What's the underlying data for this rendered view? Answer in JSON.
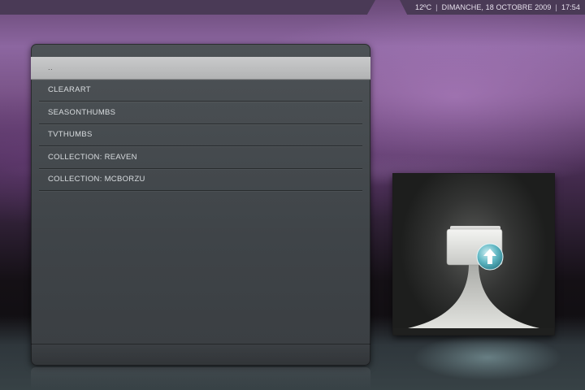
{
  "status_bar": {
    "temperature": "12ºC",
    "date": "DIMANCHE, 18 OCTOBRE 2009",
    "time": "17:54",
    "separator": "|"
  },
  "file_list": {
    "items": [
      {
        "label": "..",
        "selected": true
      },
      {
        "label": "CLEARART",
        "selected": false
      },
      {
        "label": "SEASONTHUMBS",
        "selected": false
      },
      {
        "label": "TVTHUMBS",
        "selected": false
      },
      {
        "label": "COLLECTION: REAVEN",
        "selected": false
      },
      {
        "label": "COLLECTION: MCBORZU",
        "selected": false
      }
    ]
  },
  "thumbnail": {
    "icon": "folder-up-icon"
  }
}
